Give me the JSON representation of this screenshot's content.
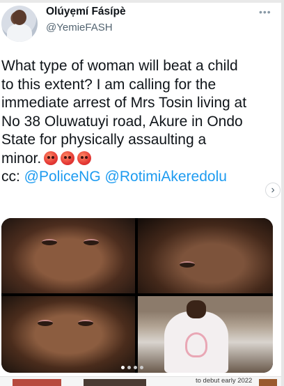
{
  "header": {
    "name": "Olúyẹmí Fásípè",
    "handle": "@YemieFASH",
    "more_icon": "more-dots-icon"
  },
  "tweet": {
    "lines": [
      "What type of woman will beat a child",
      "to this extent? I am calling for the",
      "immediate arrest of Mrs Tosin living at",
      "No 38 Oluwatuyi road, Akure in Ondo",
      "State for physically assaulting a",
      "minor."
    ],
    "emojis": [
      "angry-face-icon",
      "angry-face-icon",
      "angry-face-icon"
    ],
    "cc_prefix": "cc: ",
    "mentions": [
      "@PoliceNG",
      "@RotimiAkeredolu"
    ]
  },
  "media": {
    "photo_count": 4,
    "carousel_dots": 4,
    "active_dot": 1,
    "next_icon": "chevron-right-icon"
  },
  "footer": {
    "text": "to debut early 2022"
  },
  "colors": {
    "mention": "#1d9bf0",
    "handle": "#536471"
  }
}
